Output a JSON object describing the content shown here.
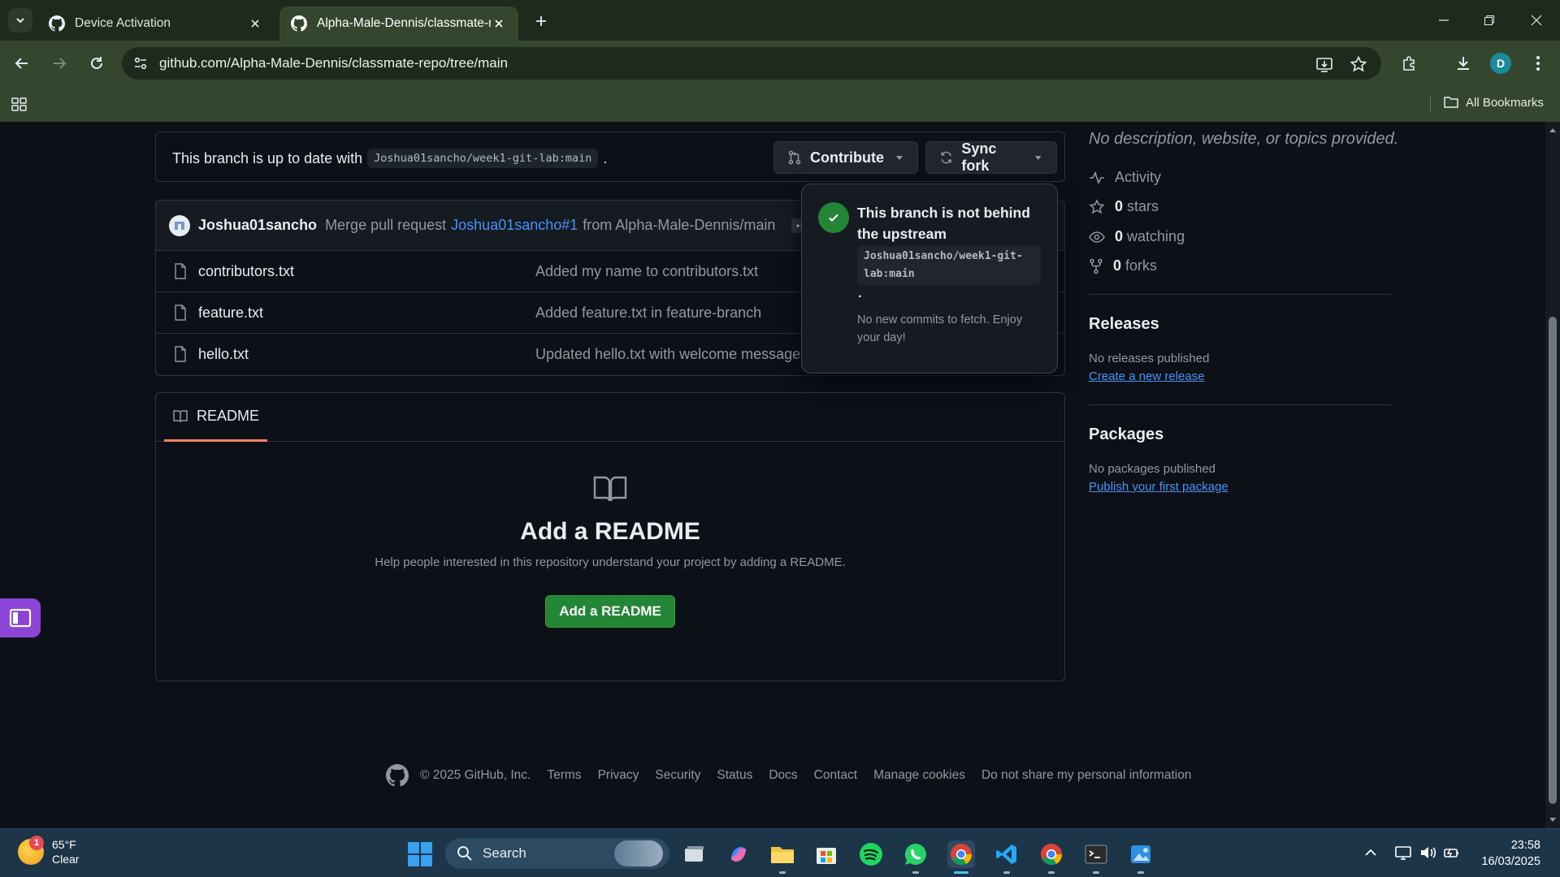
{
  "browser": {
    "tabs": [
      {
        "title": "Device Activation",
        "icon": "github-icon"
      },
      {
        "title": "Alpha-Male-Dennis/classmate-r",
        "icon": "github-icon"
      }
    ],
    "url": "github.com/Alpha-Male-Dennis/classmate-repo/tree/main",
    "profile_initial": "D",
    "bookmarks": {
      "all_label": "All Bookmarks"
    }
  },
  "repo": {
    "branch_status": {
      "text": "This branch is up to date with",
      "ref": "Joshua01sancho/week1-git-lab:main",
      "suffix": "."
    },
    "buttons": {
      "contribute": "Contribute",
      "sync_fork": "Sync fork"
    },
    "latest_commit": {
      "author": "Joshua01sancho",
      "message_prefix": "Merge pull request",
      "pr_link": "Joshua01sancho#1",
      "message_suffix": "from Alpha-Male-Dennis/main"
    },
    "files": [
      {
        "name": "contributors.txt",
        "message": "Added my name to contributors.txt"
      },
      {
        "name": "feature.txt",
        "message": "Added feature.txt in feature-branch"
      },
      {
        "name": "hello.txt",
        "message": "Updated hello.txt with welcome message"
      }
    ],
    "readme": {
      "tab_label": "README",
      "empty_title": "Add a README",
      "empty_text": "Help people interested in this repository understand your project by adding a README.",
      "button": "Add a README"
    },
    "sync_popover": {
      "title": "This branch is not behind the upstream",
      "ref": "Joshua01sancho/week1-git-lab:main",
      "dot": ".",
      "body": "No new commits to fetch. Enjoy your day!"
    }
  },
  "sidebar": {
    "description": "No description, website, or topics provided.",
    "activity": "Activity",
    "stars_count": "0",
    "stars_label": "stars",
    "watching_count": "0",
    "watching_label": "watching",
    "forks_count": "0",
    "forks_label": "forks",
    "releases": {
      "heading": "Releases",
      "empty": "No releases published",
      "link": "Create a new release"
    },
    "packages": {
      "heading": "Packages",
      "empty": "No packages published",
      "link": "Publish your first package"
    }
  },
  "footer": {
    "copyright": "© 2025 GitHub, Inc.",
    "links": [
      "Terms",
      "Privacy",
      "Security",
      "Status",
      "Docs",
      "Contact",
      "Manage cookies",
      "Do not share my personal information"
    ]
  },
  "taskbar": {
    "weather": {
      "temp": "65°F",
      "condition": "Clear",
      "badge": "1"
    },
    "search_label": "Search",
    "clock": {
      "time": "23:58",
      "date": "16/03/2025"
    }
  },
  "colors": {
    "accent_green": "#238636",
    "link_blue": "#4493f8",
    "chrome_green": "#35462f"
  }
}
